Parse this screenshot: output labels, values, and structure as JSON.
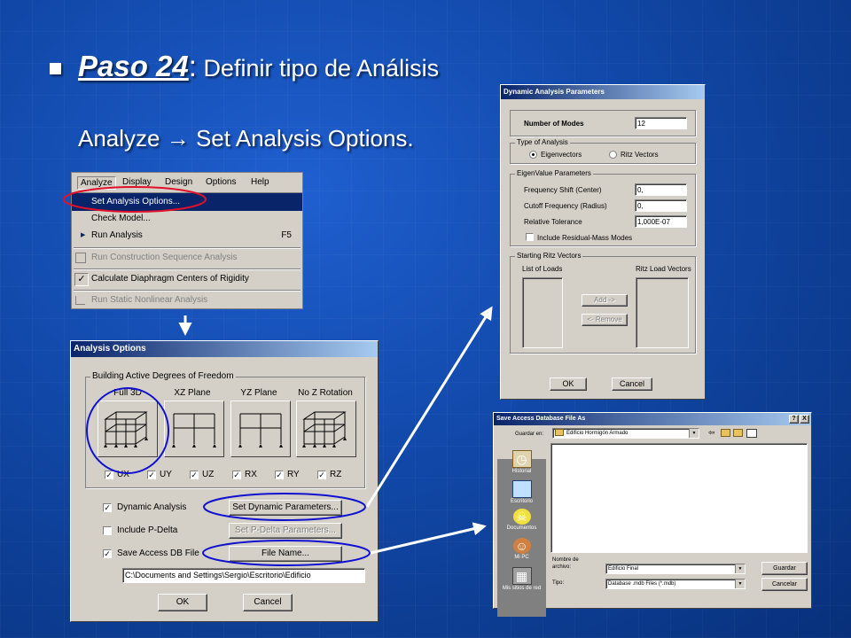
{
  "slide": {
    "step_label": "Paso 24",
    "step_sep": ":",
    "step_title": "Definir tipo de Análisis",
    "instruction": "Analyze → Set Analysis Options."
  },
  "menu": {
    "bar": [
      "Analyze",
      "Display",
      "Design",
      "Options",
      "Help"
    ],
    "items": [
      {
        "label": "Set Analysis Options...",
        "shortcut": ""
      },
      {
        "label": "Check Model...",
        "shortcut": ""
      },
      {
        "label": "Run Analysis",
        "shortcut": "F5"
      },
      {
        "label": "Run Construction Sequence Analysis",
        "shortcut": ""
      },
      {
        "label": "Calculate Diaphragm Centers of Rigidity",
        "shortcut": ""
      },
      {
        "label": "Run Static Nonlinear Analysis",
        "shortcut": ""
      }
    ],
    "check_mark": "✓",
    "run_glyph": "▶"
  },
  "analysis_options": {
    "title": "Analysis Options",
    "group_label": "Building Active Degrees of Freedom",
    "presets": [
      "Full 3D",
      "XZ Plane",
      "YZ Plane",
      "No Z Rotation"
    ],
    "dofs": [
      "UX",
      "UY",
      "UZ",
      "RX",
      "RY",
      "RZ"
    ],
    "dynamic_label": "Dynamic Analysis",
    "dynamic_button": "Set Dynamic Parameters...",
    "pdelta_label": "Include P-Delta",
    "pdelta_button": "Set P-Delta Parameters...",
    "save_db_label": "Save Access DB File",
    "file_button": "File Name...",
    "path": "C:\\Documents and Settings\\Sergio\\Escritorio\\Edificio",
    "ok": "OK",
    "cancel": "Cancel"
  },
  "dynamic_params": {
    "title": "Dynamic Analysis Parameters",
    "modes_label": "Number of Modes",
    "modes_value": "12",
    "type_group": "Type of Analysis",
    "eigen_label": "Eigenvectors",
    "ritz_label": "Ritz Vectors",
    "eigen_group": "EigenValue Parameters",
    "shift_label": "Frequency Shift (Center)",
    "shift_value": "0,",
    "cutoff_label": "Cutoff Frequency (Radius)",
    "cutoff_value": "0,",
    "tol_label": "Relative Tolerance",
    "tol_value": "1,000E-07",
    "residual_label": "Include Residual-Mass Modes",
    "ritz_group": "Starting Ritz Vectors",
    "loads_label": "List of Loads",
    "ritz_loads_label": "Ritz Load Vectors",
    "add_button": "Add ->",
    "remove_button": "<- Remove",
    "ok": "OK",
    "cancel": "Cancel"
  },
  "save_dialog": {
    "title": "Save Access Database File As",
    "help_glyph": "?",
    "close_glyph": "X",
    "save_in_label": "Guardar en:",
    "save_in_value": "Edificio Hormigón Armado",
    "places": [
      "Historial",
      "Escritorio",
      "Documentos",
      "Mi PC",
      "Mis sitios de red"
    ],
    "filename_label_1": "Nombre de",
    "filename_label_2": "archivo:",
    "filename_value": "Edificio Final",
    "type_label": "Tipo:",
    "type_value": "Database .mdb Files (*.mdb)",
    "save_button": "Guardar",
    "cancel_button": "Cancelar"
  },
  "colors": {
    "highlight_red": "#e0102a",
    "highlight_blue": "#1010d0",
    "arrow": "#ffffff"
  }
}
